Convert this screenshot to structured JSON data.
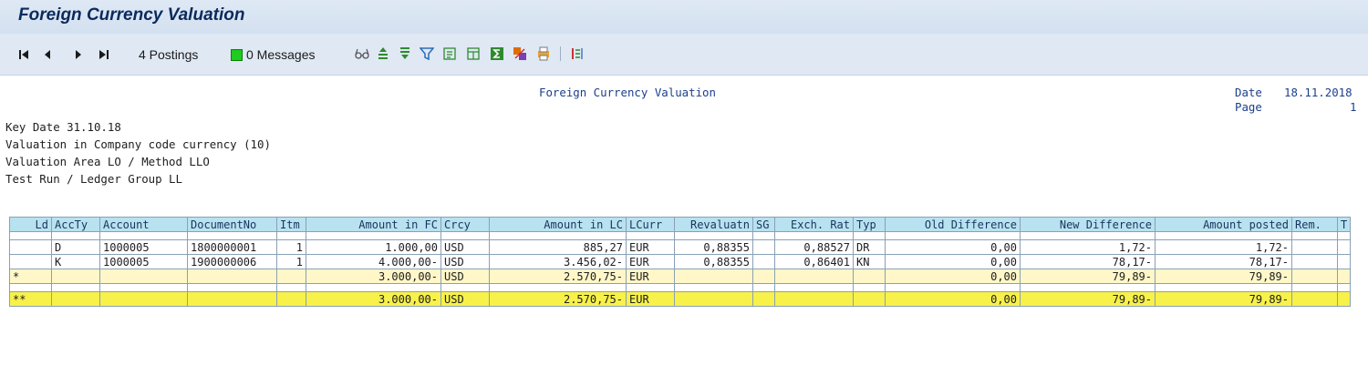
{
  "window": {
    "title": "Foreign Currency Valuation"
  },
  "toolbar": {
    "nav": [
      "|◀",
      "◀",
      "▶",
      "▶|"
    ],
    "postings": "4 Postings",
    "messages": "0 Messages",
    "icons": [
      "glasses-icon",
      "sort-asc-icon",
      "sort-desc-icon",
      "filter-icon",
      "export-icon",
      "layout-icon",
      "sum-icon",
      "subtotal-icon",
      "print-icon",
      "columns-icon"
    ]
  },
  "report": {
    "heading": "Foreign Currency Valuation",
    "date_label": "Date",
    "date_value": "18.11.2018",
    "page_label": "Page",
    "page_value": "1",
    "lines": [
      "Key Date 31.10.18",
      "Valuation in Company code currency (10)",
      "Valuation Area LO / Method LLO",
      "Test Run / Ledger Group LL"
    ]
  },
  "table": {
    "headers": [
      "Ld",
      "AccTy",
      "Account",
      "DocumentNo",
      "Itm",
      "Amount in FC",
      "Crcy",
      "Amount in LC",
      "LCurr",
      "Revaluatn",
      "SG",
      "Exch. Rat",
      "Typ",
      "Old Difference",
      "New Difference",
      "Amount posted",
      "Rem.",
      "T"
    ],
    "rows": [
      [
        "",
        "D",
        "1000005",
        "1800000001",
        "1",
        "1.000,00",
        "USD",
        "885,27",
        "EUR",
        "0,88355",
        "",
        "0,88527",
        "DR",
        "0,00",
        "1,72-",
        "1,72-",
        "",
        ""
      ],
      [
        "",
        "K",
        "1000005",
        "1900000006",
        "1",
        "4.000,00-",
        "USD",
        "3.456,02-",
        "EUR",
        "0,88355",
        "",
        "0,86401",
        "KN",
        "0,00",
        "78,17-",
        "78,17-",
        "",
        ""
      ]
    ],
    "subtotal": [
      "*",
      "",
      "",
      "",
      "",
      "3.000,00-",
      "USD",
      "2.570,75-",
      "EUR",
      "",
      "",
      "",
      "",
      "0,00",
      "79,89-",
      "79,89-",
      "",
      ""
    ],
    "total": [
      "**",
      "",
      "",
      "",
      "",
      "3.000,00-",
      "USD",
      "2.570,75-",
      "EUR",
      "",
      "",
      "",
      "",
      "0,00",
      "79,89-",
      "79,89-",
      "",
      ""
    ]
  }
}
